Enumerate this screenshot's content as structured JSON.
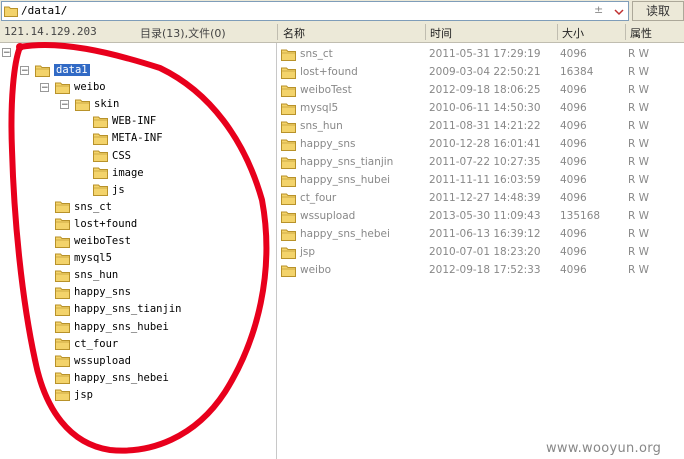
{
  "address": {
    "path": "/data1/",
    "sort_glyph": "±",
    "read_label": "读取"
  },
  "header": {
    "ip": "121.14.129.203",
    "info": "目录(13),文件(0)",
    "col_name": "名称",
    "col_time": "时间",
    "col_size": "大小",
    "col_attr": "属性"
  },
  "tree": {
    "root_label": "/",
    "nodes": [
      {
        "label": "data1",
        "depth": 1,
        "toggle": "−",
        "selected": true,
        "open": true
      },
      {
        "label": "weibo",
        "depth": 2,
        "toggle": "−",
        "selected": false,
        "open": true
      },
      {
        "label": "skin",
        "depth": 3,
        "toggle": "−",
        "selected": false,
        "open": true
      },
      {
        "label": "WEB-INF",
        "depth": 4,
        "toggle": "",
        "selected": false,
        "open": false
      },
      {
        "label": "META-INF",
        "depth": 4,
        "toggle": "",
        "selected": false,
        "open": false
      },
      {
        "label": "CSS",
        "depth": 4,
        "toggle": "",
        "selected": false,
        "open": false
      },
      {
        "label": "image",
        "depth": 4,
        "toggle": "",
        "selected": false,
        "open": false
      },
      {
        "label": "js",
        "depth": 4,
        "toggle": "",
        "selected": false,
        "open": false
      },
      {
        "label": "sns_ct",
        "depth": 2,
        "toggle": "",
        "selected": false,
        "open": false
      },
      {
        "label": "lost+found",
        "depth": 2,
        "toggle": "",
        "selected": false,
        "open": false
      },
      {
        "label": "weiboTest",
        "depth": 2,
        "toggle": "",
        "selected": false,
        "open": false
      },
      {
        "label": "mysql5",
        "depth": 2,
        "toggle": "",
        "selected": false,
        "open": false
      },
      {
        "label": "sns_hun",
        "depth": 2,
        "toggle": "",
        "selected": false,
        "open": false
      },
      {
        "label": "happy_sns",
        "depth": 2,
        "toggle": "",
        "selected": false,
        "open": false
      },
      {
        "label": "happy_sns_tianjin",
        "depth": 2,
        "toggle": "",
        "selected": false,
        "open": false
      },
      {
        "label": "happy_sns_hubei",
        "depth": 2,
        "toggle": "",
        "selected": false,
        "open": false
      },
      {
        "label": "ct_four",
        "depth": 2,
        "toggle": "",
        "selected": false,
        "open": false
      },
      {
        "label": "wssupload",
        "depth": 2,
        "toggle": "",
        "selected": false,
        "open": false
      },
      {
        "label": "happy_sns_hebei",
        "depth": 2,
        "toggle": "",
        "selected": false,
        "open": false
      },
      {
        "label": "jsp",
        "depth": 2,
        "toggle": "",
        "selected": false,
        "open": false
      }
    ]
  },
  "files": [
    {
      "name": "sns_ct",
      "time": "2011-05-31 17:29:19",
      "size": "4096",
      "attr": "R W"
    },
    {
      "name": "lost+found",
      "time": "2009-03-04 22:50:21",
      "size": "16384",
      "attr": "R W"
    },
    {
      "name": "weiboTest",
      "time": "2012-09-18 18:06:25",
      "size": "4096",
      "attr": "R W"
    },
    {
      "name": "mysql5",
      "time": "2010-06-11 14:50:30",
      "size": "4096",
      "attr": "R W"
    },
    {
      "name": "sns_hun",
      "time": "2011-08-31 14:21:22",
      "size": "4096",
      "attr": "R W"
    },
    {
      "name": "happy_sns",
      "time": "2010-12-28 16:01:41",
      "size": "4096",
      "attr": "R W"
    },
    {
      "name": "happy_sns_tianjin",
      "time": "2011-07-22 10:27:35",
      "size": "4096",
      "attr": "R W"
    },
    {
      "name": "happy_sns_hubei",
      "time": "2011-11-11 16:03:59",
      "size": "4096",
      "attr": "R W"
    },
    {
      "name": "ct_four",
      "time": "2011-12-27 14:48:39",
      "size": "4096",
      "attr": "R W"
    },
    {
      "name": "wssupload",
      "time": "2013-05-30 11:09:43",
      "size": "135168",
      "attr": "R W"
    },
    {
      "name": "happy_sns_hebei",
      "time": "2011-06-13 16:39:12",
      "size": "4096",
      "attr": "R W"
    },
    {
      "name": "jsp",
      "time": "2010-07-01 18:23:20",
      "size": "4096",
      "attr": "R W"
    },
    {
      "name": "weibo",
      "time": "2012-09-18 17:52:33",
      "size": "4096",
      "attr": "R W"
    }
  ],
  "watermark": "www.wooyun.org",
  "colors": {
    "folder": "#f3d36b",
    "folder_edge": "#b8922a",
    "selection": "#316ac5",
    "annotation": "#e8001c"
  },
  "icons": {
    "folder": "folder-icon",
    "dropdown": "chevron-down-icon"
  }
}
